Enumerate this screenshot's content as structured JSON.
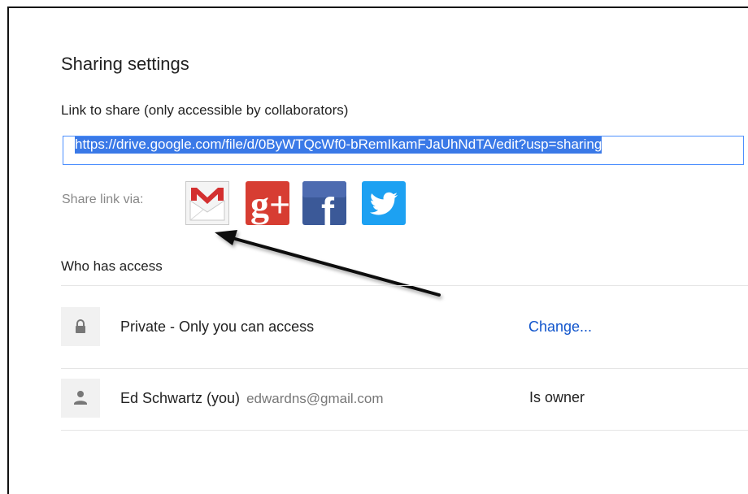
{
  "dialog": {
    "title": "Sharing settings",
    "link_label": "Link to share (only accessible by collaborators)",
    "link_url": "https://drive.google.com/file/d/0ByWTQcWf0-bRemIkamFJaUhNdTA/edit?usp=sharing",
    "share_via_label": "Share link via:",
    "share_options": [
      {
        "name": "Gmail",
        "icon": "gmail-icon"
      },
      {
        "name": "Google+",
        "icon": "google-plus-icon",
        "glyph": "g+"
      },
      {
        "name": "Facebook",
        "icon": "facebook-icon",
        "glyph": "f"
      },
      {
        "name": "Twitter",
        "icon": "twitter-icon"
      }
    ],
    "who_has_access_label": "Who has access",
    "access_rows": [
      {
        "icon": "lock-icon",
        "label": "Private - Only you can access",
        "action": "Change..."
      },
      {
        "icon": "person-icon",
        "name": "Ed Schwartz (you)",
        "email": "edwardns@gmail.com",
        "role": "Is owner"
      }
    ]
  },
  "colors": {
    "accent_blue": "#1155cc",
    "input_border": "#4d90fe",
    "selection": "#3a79e7",
    "gplus_red": "#d73d32",
    "facebook_blue": "#3b5998",
    "twitter_blue": "#1da1f2"
  }
}
